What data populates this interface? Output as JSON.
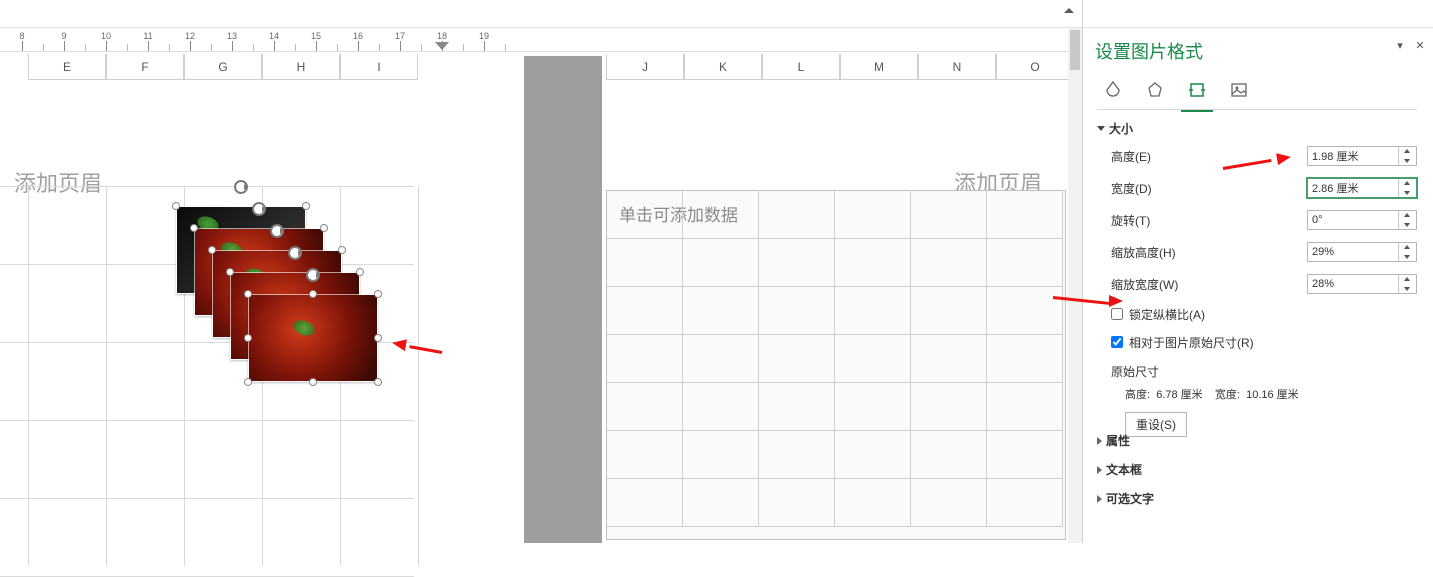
{
  "ruler": {
    "start": 8,
    "end": 19,
    "cursor_at": 18
  },
  "columns_left": [
    "E",
    "F",
    "G",
    "H",
    "I"
  ],
  "columns_right": [
    "J",
    "K",
    "L",
    "M",
    "N",
    "O"
  ],
  "header_placeholder": "添加页眉",
  "table_placeholder": "单击可添加数据",
  "sidebar": {
    "title": "设置图片格式",
    "sections": {
      "size": {
        "header": "大小",
        "height_label": "高度(E)",
        "height_value": "1.98 厘米",
        "width_label": "宽度(D)",
        "width_value": "2.86 厘米",
        "rotation_label": "旋转(T)",
        "rotation_value": "0°",
        "scale_h_label": "缩放高度(H)",
        "scale_h_value": "29%",
        "scale_w_label": "缩放宽度(W)",
        "scale_w_value": "28%",
        "lock_aspect_label": "锁定纵横比(A)",
        "lock_aspect_checked": false,
        "relative_original_label": "相对于图片原始尺寸(R)",
        "relative_original_checked": true,
        "original_header": "原始尺寸",
        "original_height_label": "高度:",
        "original_height_value": "6.78 厘米",
        "original_width_label": "宽度:",
        "original_width_value": "10.16 厘米",
        "reset_label": "重设(S)"
      },
      "properties_header": "属性",
      "textbox_header": "文本框",
      "alttext_header": "可选文字"
    }
  }
}
